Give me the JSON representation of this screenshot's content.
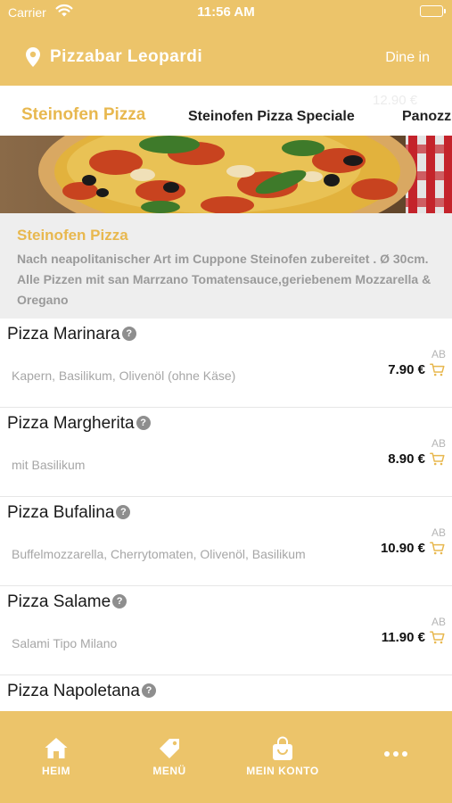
{
  "status_bar": {
    "carrier": "Carrier",
    "time": "11:56 AM"
  },
  "app_bar": {
    "restaurant_name": "Pizzabar Leopardi",
    "order_mode": "Dine in"
  },
  "tabs": {
    "partial_price": "12.90 €",
    "items": [
      {
        "label": "Steinofen Pizza"
      },
      {
        "label": "Steinofen Pizza Speciale"
      },
      {
        "label": "Panozz"
      }
    ]
  },
  "category": {
    "title": "Steinofen Pizza",
    "description": "Nach neapolitanischer Art im Cuppone Steinofen zubereitet . Ø 30cm. Alle Pizzen mit san Marrzano Tomatensauce,geriebenem Mozzarella & Oregano"
  },
  "items": [
    {
      "name": "Pizza Marinara",
      "description": "Kapern, Basilikum, Olivenöl (ohne Käse)",
      "prefix": "AB",
      "price": "7.90 €"
    },
    {
      "name": "Pizza Margherita",
      "description": "mit Basilikum",
      "prefix": "AB",
      "price": "8.90 €"
    },
    {
      "name": "Pizza Bufalina",
      "description": "Buffelmozzarella, Cherrytomaten, Olivenöl, Basilikum",
      "prefix": "AB",
      "price": "10.90 €"
    },
    {
      "name": "Pizza Salame",
      "description": "Salami Tipo Milano",
      "prefix": "AB",
      "price": "11.90 €"
    },
    {
      "name": "Pizza Napoletana"
    }
  ],
  "bottom_nav": [
    {
      "label": "HEIM",
      "icon": "home-icon"
    },
    {
      "label": "MENÜ",
      "icon": "tag-icon"
    },
    {
      "label": "MEIN KONTO",
      "icon": "bag-icon"
    },
    {
      "label": "",
      "icon": "more-icon"
    }
  ],
  "colors": {
    "primary": "#ecc46a",
    "accent": "#e8b84f",
    "background": "#ffffff",
    "description_bg": "#eeeeee"
  }
}
